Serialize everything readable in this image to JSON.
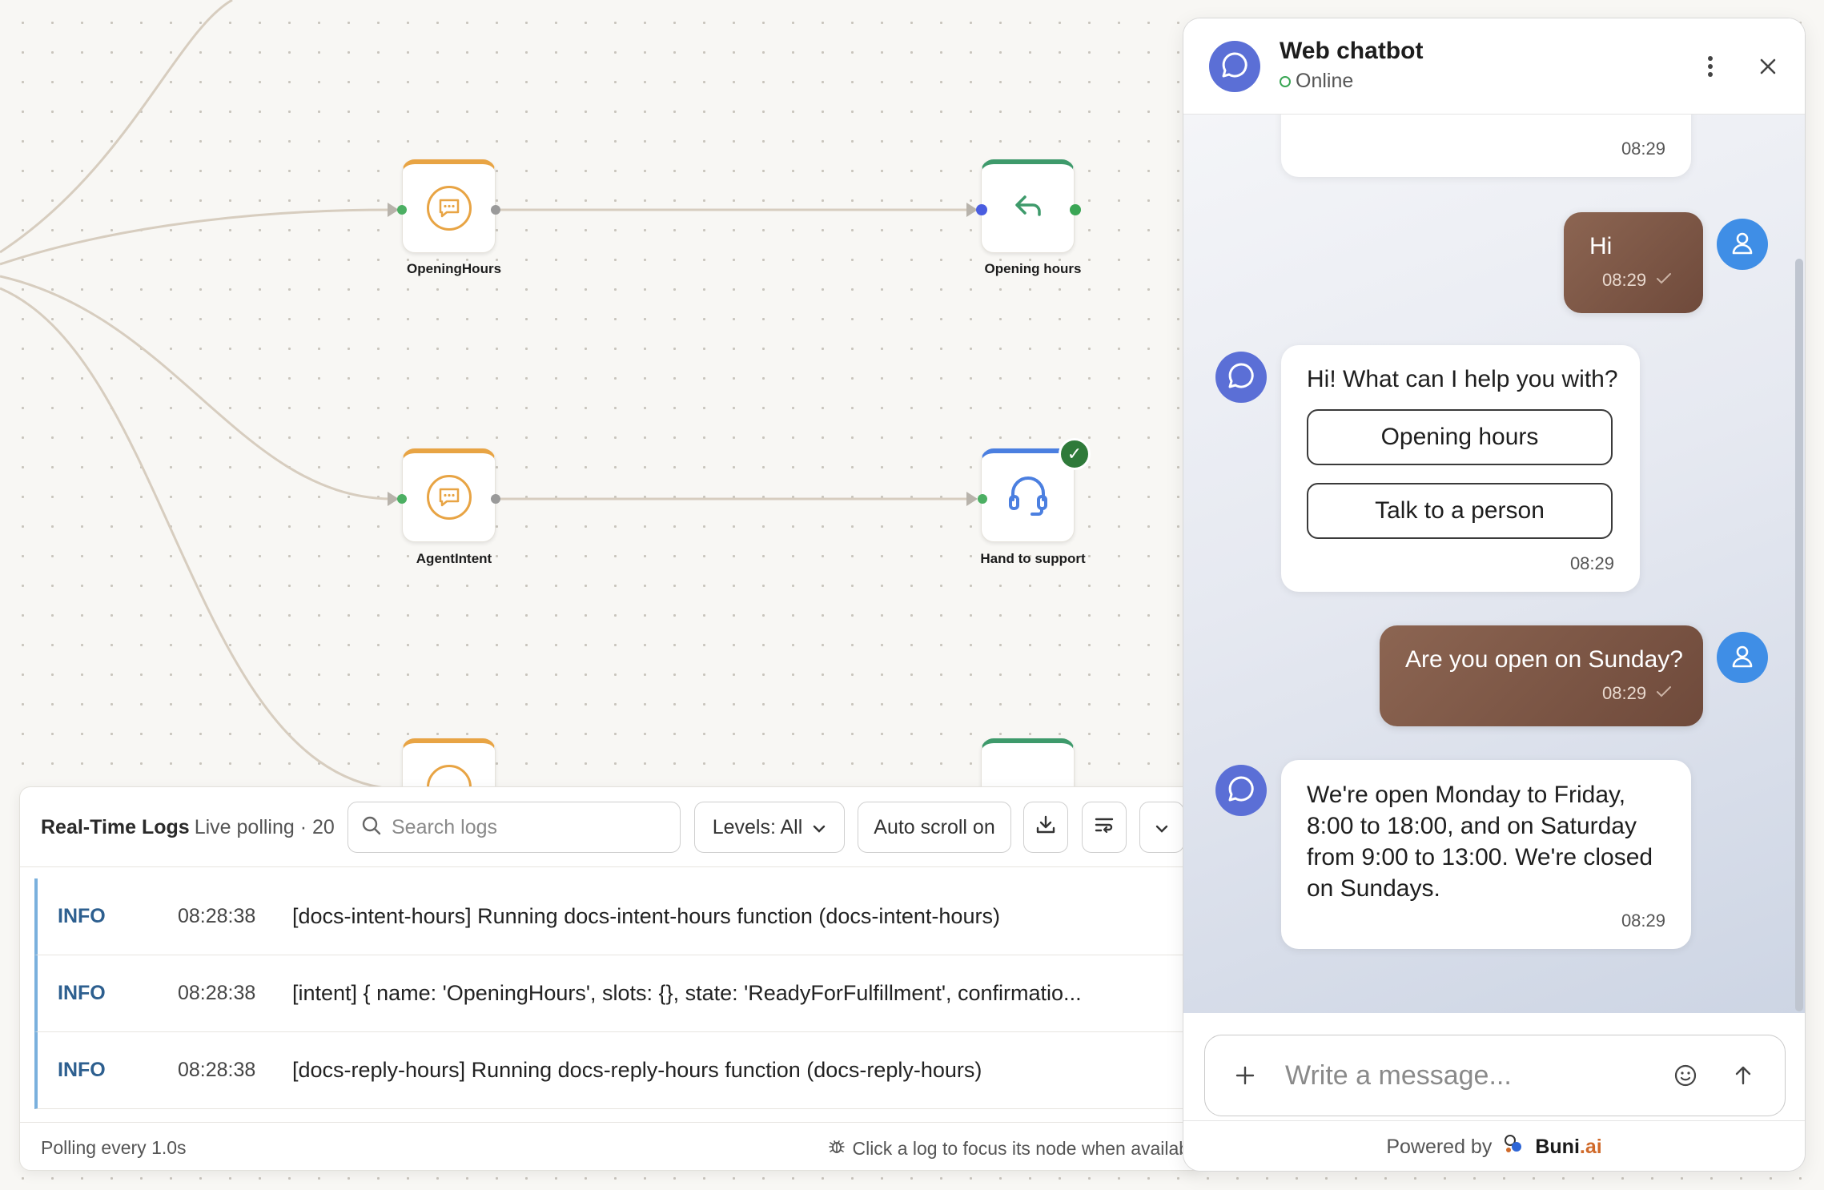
{
  "flow": {
    "nodes": [
      {
        "label": "OpeningHours",
        "icon": "chat-bubble-icon",
        "accent": "#e8a444"
      },
      {
        "label": "Opening hours",
        "icon": "reply-arrow-icon",
        "accent": "#3e9a6b"
      },
      {
        "label": "AgentIntent",
        "icon": "chat-bubble-icon",
        "accent": "#e8a444"
      },
      {
        "label": "Hand to support",
        "icon": "headset-icon",
        "accent": "#4b7fe0"
      }
    ]
  },
  "logs": {
    "title": "Real-Time Logs",
    "subtitle": "Live polling · 20",
    "search_placeholder": "Search logs",
    "levels_label": "Levels: All",
    "autoscroll_label": "Auto scroll on",
    "rows": [
      {
        "level": "INFO",
        "time": "08:28:38",
        "message": "[docs-intent-hours] Running docs-intent-hours function (docs-intent-hours)"
      },
      {
        "level": "INFO",
        "time": "08:28:38",
        "message": "[intent] { name: 'OpeningHours', slots: {}, state: 'ReadyForFulfillment', confirmatio..."
      },
      {
        "level": "INFO",
        "time": "08:28:38",
        "message": "[docs-reply-hours] Running docs-reply-hours function (docs-reply-hours)"
      }
    ],
    "footer_left": "Polling every 1.0s",
    "footer_right": "Click a log to focus its node when available"
  },
  "chat": {
    "title": "Web chatbot",
    "status": "Online",
    "messages": {
      "m0": {
        "time": "08:29"
      },
      "m1": {
        "text": "Hi",
        "time": "08:29"
      },
      "m2": {
        "text": "Hi! What can I help you with?",
        "options": [
          "Opening hours",
          "Talk to a person"
        ],
        "time": "08:29"
      },
      "m3": {
        "text": "Are you open on Sunday?",
        "time": "08:29"
      },
      "m4": {
        "lines": [
          "We're open Monday to Friday,",
          "8:00 to 18:00, and on Saturday",
          "from 9:00 to 13:00. We're closed",
          "on Sundays."
        ],
        "time": "08:29"
      }
    },
    "input_placeholder": "Write a message...",
    "powered_by": "Powered by",
    "brand_name": "Buni",
    "brand_suffix": ".ai"
  },
  "colors": {
    "accent_orange": "#e8a444",
    "accent_green": "#3e9a6b",
    "accent_blue": "#4b7fe0",
    "user_bubble": "#7d5646",
    "bot_avatar": "#5b6fd6",
    "user_avatar": "#3f8ee6"
  }
}
